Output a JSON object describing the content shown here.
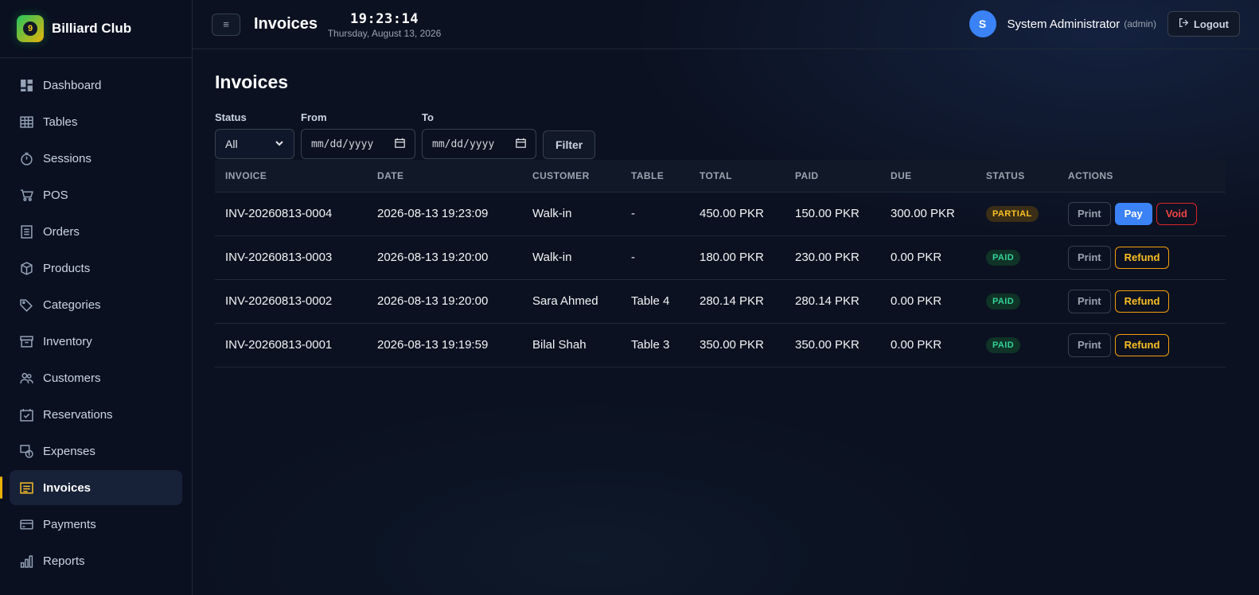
{
  "brand": {
    "name": "Billiard Club",
    "logo_text": "9"
  },
  "sidebar": {
    "items": [
      {
        "label": "Dashboard",
        "icon": "dashboard-icon",
        "active": false
      },
      {
        "label": "Tables",
        "icon": "table-grid-icon",
        "active": false
      },
      {
        "label": "Sessions",
        "icon": "stopwatch-icon",
        "active": false
      },
      {
        "label": "POS",
        "icon": "cart-icon",
        "active": false
      },
      {
        "label": "Orders",
        "icon": "receipt-icon",
        "active": false
      },
      {
        "label": "Products",
        "icon": "box-icon",
        "active": false
      },
      {
        "label": "Categories",
        "icon": "tags-icon",
        "active": false
      },
      {
        "label": "Inventory",
        "icon": "archive-icon",
        "active": false
      },
      {
        "label": "Customers",
        "icon": "people-icon",
        "active": false
      },
      {
        "label": "Reservations",
        "icon": "calendar-check-icon",
        "active": false
      },
      {
        "label": "Expenses",
        "icon": "cash-coin-icon",
        "active": false
      },
      {
        "label": "Invoices",
        "icon": "invoice-icon",
        "active": true
      },
      {
        "label": "Payments",
        "icon": "credit-card-icon",
        "active": false
      },
      {
        "label": "Reports",
        "icon": "bar-chart-icon",
        "active": false
      }
    ]
  },
  "header": {
    "menu_icon": "≡",
    "title": "Invoices",
    "time": "19:23:14",
    "date": "Thursday, August 13, 2026",
    "user": {
      "initial": "S",
      "name": "System Administrator",
      "role": "(admin)"
    },
    "logout_label": "Logout"
  },
  "page": {
    "title": "Invoices",
    "filters": {
      "status_label": "Status",
      "status_value": "All",
      "from_label": "From",
      "from_placeholder": "mm/dd/yyyy",
      "to_label": "To",
      "to_placeholder": "mm/dd/yyyy",
      "filter_button": "Filter"
    },
    "table": {
      "headers": [
        "INVOICE",
        "DATE",
        "CUSTOMER",
        "TABLE",
        "TOTAL",
        "PAID",
        "DUE",
        "STATUS",
        "ACTIONS"
      ],
      "rows": [
        {
          "invoice": "INV-20260813-0004",
          "date": "2026-08-13 19:23:09",
          "customer": "Walk-in",
          "table": "-",
          "total": "450.00 PKR",
          "paid": "150.00 PKR",
          "due": "300.00 PKR",
          "status": "PARTIAL",
          "actions": [
            "Print",
            "Pay",
            "Void"
          ]
        },
        {
          "invoice": "INV-20260813-0003",
          "date": "2026-08-13 19:20:00",
          "customer": "Walk-in",
          "table": "-",
          "total": "180.00 PKR",
          "paid": "230.00 PKR",
          "due": "0.00 PKR",
          "status": "PAID",
          "actions": [
            "Print",
            "Refund"
          ]
        },
        {
          "invoice": "INV-20260813-0002",
          "date": "2026-08-13 19:20:00",
          "customer": "Sara Ahmed",
          "table": "Table 4",
          "total": "280.14 PKR",
          "paid": "280.14 PKR",
          "due": "0.00 PKR",
          "status": "PAID",
          "actions": [
            "Print",
            "Refund"
          ]
        },
        {
          "invoice": "INV-20260813-0001",
          "date": "2026-08-13 19:19:59",
          "customer": "Bilal Shah",
          "table": "Table 3",
          "total": "350.00 PKR",
          "paid": "350.00 PKR",
          "due": "0.00 PKR",
          "status": "PAID",
          "actions": [
            "Print",
            "Refund"
          ]
        }
      ]
    }
  },
  "colors": {
    "background": "#0b1120",
    "accent": "#3b82f6",
    "active_marker": "#eab308",
    "partial": "#fbbf24",
    "paid": "#34d399",
    "danger": "#ef4444"
  }
}
